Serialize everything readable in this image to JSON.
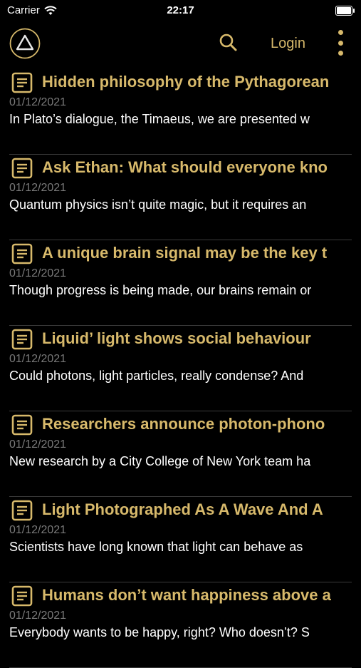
{
  "status_bar": {
    "carrier": "Carrier",
    "time": "22:17"
  },
  "nav": {
    "login_label": "Login",
    "accent_color": "#d7b96b"
  },
  "articles": [
    {
      "title": "Hidden philosophy of the Pythagorean",
      "date": "01/12/2021",
      "snippet": "In Plato’s dialogue, the Timaeus, we are presented w"
    },
    {
      "title": "Ask Ethan: What should everyone kno",
      "date": "01/12/2021",
      "snippet": "Quantum physics isn’t quite magic, but it requires an"
    },
    {
      "title": "A unique brain signal may be the key t",
      "date": "01/12/2021",
      "snippet": "Though progress is being made, our brains remain or"
    },
    {
      "title": "Liquid’ light shows social behaviour",
      "date": "01/12/2021",
      "snippet": "Could photons, light particles, really condense? And"
    },
    {
      "title": "Researchers announce photon-phono",
      "date": "01/12/2021",
      "snippet": "New research by a City College of New York team ha"
    },
    {
      "title": "Light Photographed As A Wave And A",
      "date": "01/12/2021",
      "snippet": "Scientists have long known that light can behave as"
    },
    {
      "title": "Humans don’t want happiness above a",
      "date": "01/12/2021",
      "snippet": "Everybody wants to be happy, right? Who doesn’t? S"
    }
  ]
}
